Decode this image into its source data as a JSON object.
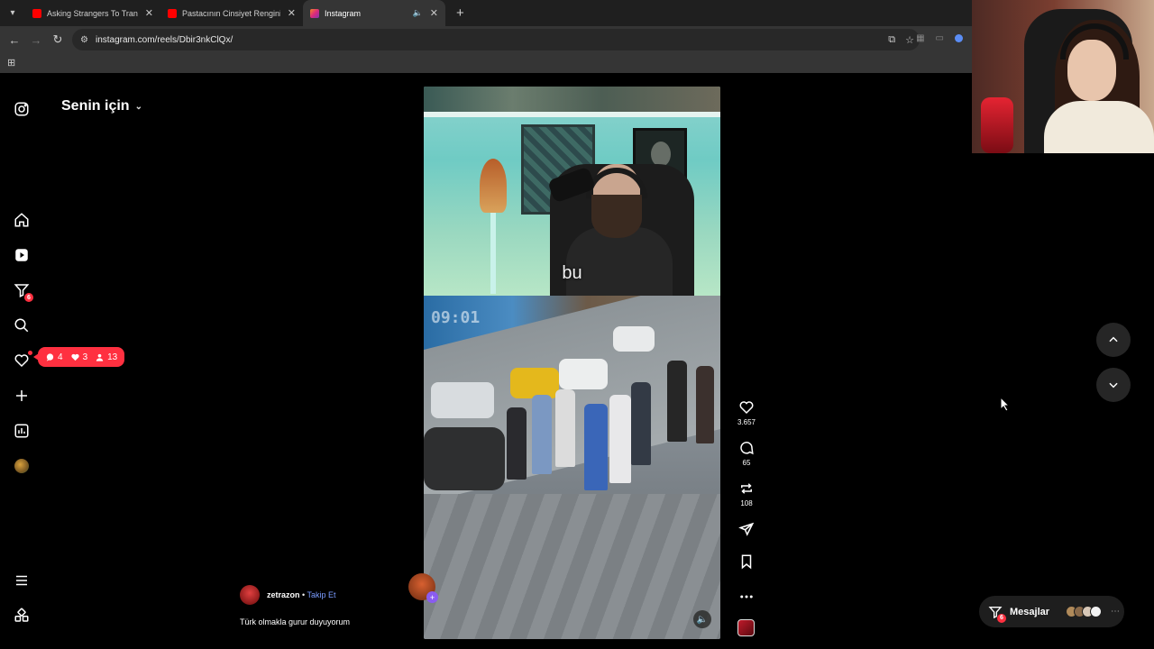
{
  "browser": {
    "tabs": [
      {
        "title": "Asking Strangers To Transform",
        "favicon_color": "#ff0000",
        "active": false
      },
      {
        "title": "Pastacının Cinsiyet Rengini Karıştırdı",
        "favicon_color": "#ff0000",
        "active": false
      },
      {
        "title": "Instagram",
        "favicon_color": "#e1306c",
        "active": true
      }
    ],
    "url": "instagram.com/reels/Dbir3nkClQx/"
  },
  "instagram": {
    "feed_title": "Senin için",
    "notifications": {
      "comments": "4",
      "likes": "3",
      "follows": "13"
    },
    "sidebar": {
      "filter_badge": "6",
      "items": [
        "home",
        "reels",
        "filter",
        "search",
        "notifications",
        "create",
        "dashboard",
        "profile",
        "more",
        "meta"
      ]
    },
    "video": {
      "subtitle": "bu",
      "timestamp": "09:01"
    },
    "actions": {
      "likes": "3.657",
      "comments": "65",
      "reposts": "108"
    },
    "post": {
      "username": "zetrazon",
      "separator": "•",
      "follow_label": "Takip Et",
      "caption": "Türk olmakla gurur duyuyorum"
    },
    "messages": {
      "label": "Mesajlar",
      "badge": "6"
    }
  },
  "colors": {
    "accent_red": "#ff3040",
    "follow_blue": "#7a9cff",
    "background": "#000000"
  }
}
